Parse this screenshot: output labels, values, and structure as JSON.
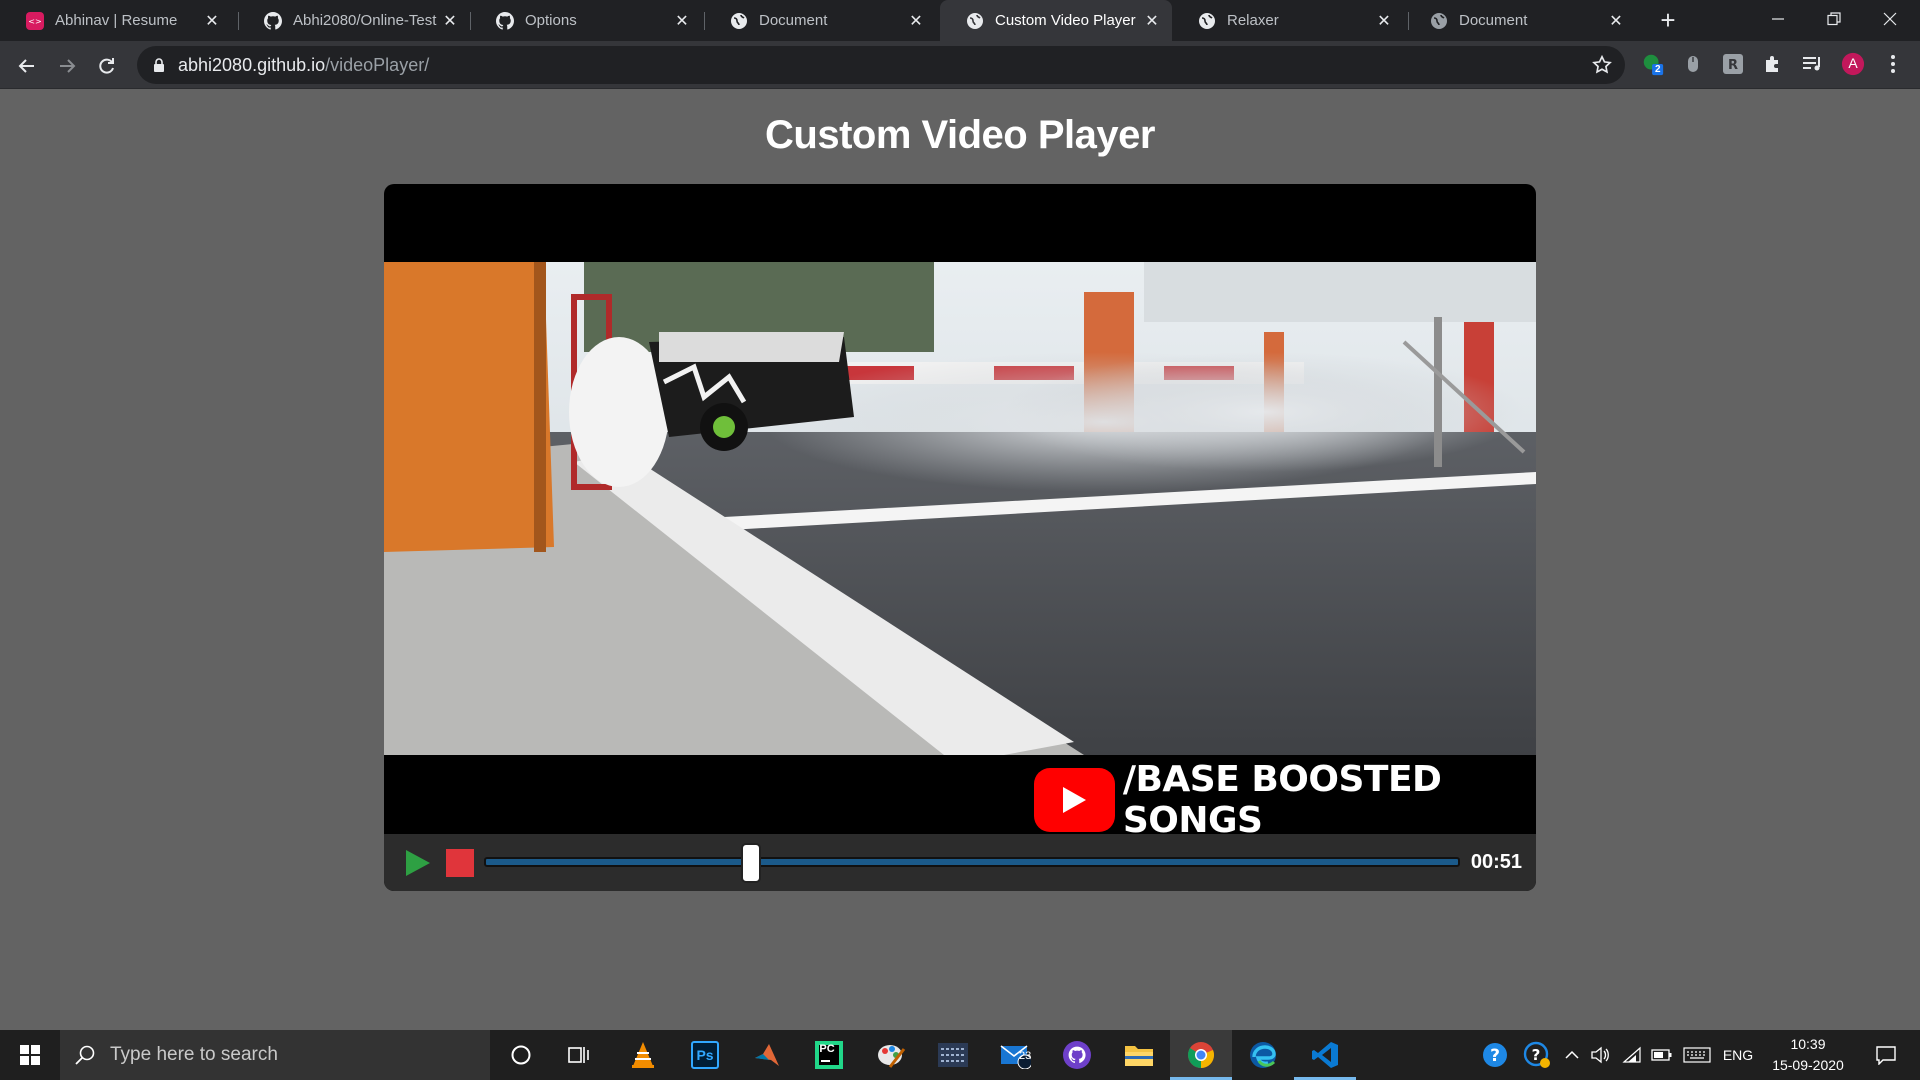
{
  "browser": {
    "tabs": [
      {
        "title": "Abhinav | Resume",
        "icon": "resume-favicon",
        "active": false
      },
      {
        "title": "Abhi2080/Online-Test",
        "icon": "github-icon",
        "active": false
      },
      {
        "title": "Options",
        "icon": "github-icon",
        "active": false
      },
      {
        "title": "Document",
        "icon": "globe-icon",
        "active": false
      },
      {
        "title": "Custom Video Player",
        "icon": "globe-icon",
        "active": true
      },
      {
        "title": "Relaxer",
        "icon": "globe-icon",
        "active": false
      },
      {
        "title": "Document",
        "icon": "globe-icon",
        "active": false
      }
    ],
    "address": {
      "host": "abhi2080.github.io",
      "path": "/videoPlayer/"
    },
    "extension_badge": "2",
    "profile_initial": "A",
    "colors": {
      "profile": "#c2185b",
      "accent": "#8ab4f8"
    }
  },
  "page": {
    "title": "Custom Video Player",
    "player": {
      "watermark_text": "/BASE BOOSTED SONGS",
      "current_time": "00:51",
      "progress": 0.275,
      "colors": {
        "play": "#2ea043",
        "stop": "#e0353b",
        "bar": "#1b5a8a"
      }
    }
  },
  "taskbar": {
    "search_placeholder": "Type here to search",
    "apps": [
      "cortana-icon",
      "task-view-icon",
      "vlc-icon",
      "photoshop-icon",
      "matlab-icon",
      "pycharm-icon",
      "paint-icon",
      "media-app-icon",
      "mail-icon",
      "github-desktop-icon",
      "file-explorer-icon",
      "chrome-icon",
      "edge-icon",
      "vscode-icon"
    ],
    "ps_label": "Ps",
    "pc_label": "PC",
    "mail_badge": "23",
    "language": "ENG",
    "time": "10:39",
    "date": "15-09-2020"
  }
}
